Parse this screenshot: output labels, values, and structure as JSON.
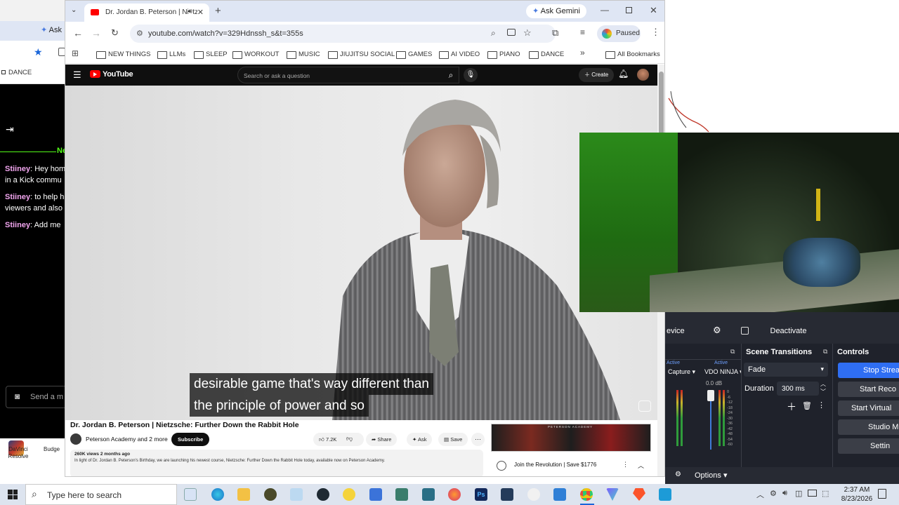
{
  "left_window": {
    "tab_label": "Ask",
    "bookmark": "DANCE",
    "chat": [
      {
        "name": "Stiiney",
        "text": ": Hey hom",
        "text2": "in a Kick commu"
      },
      {
        "name": "Stiiney",
        "text": ": to help h",
        "text2": "viewers and also"
      },
      {
        "name": "Stiiney",
        "text": ": Add me",
        "text2": ""
      }
    ],
    "chat_header": "Ne",
    "send_placeholder": "Send a m",
    "desktop_icons": [
      "DaVinci Resolve",
      "Budge"
    ]
  },
  "chrome": {
    "tab_title": "Dr. Jordan B. Peterson | Nietz",
    "ask_gemini": "Ask Gemini",
    "url": "youtube.com/watch?v=329Hdnssh_s&t=355s",
    "profile_status": "Paused",
    "bookmarks": [
      "NEW THINGS",
      "LLMs",
      "SLEEP",
      "WORKOUT",
      "MUSIC",
      "JIUJITSU SOCIAL",
      "GAMES",
      "AI VIDEO",
      "PIANO",
      "DANCE"
    ],
    "all_bookmarks": "All Bookmarks",
    "more_bookmarks": "»"
  },
  "youtube": {
    "logo": "YouTube",
    "search_placeholder": "Search or ask a question",
    "create_label": "Create",
    "caption_line1": "desirable game that's way different than",
    "caption_line2": "the principle of power and so",
    "video_title": "Dr. Jordan B. Peterson | Nietzsche: Further Down the Rabbit Hole",
    "channel": "Peterson Academy and 2 more",
    "subscribe": "Subscribe",
    "likes": "7.2K",
    "share": "Share",
    "ask": "Ask",
    "save": "Save",
    "views": "260K views  2 months ago",
    "description": "In light of Dr. Jordan B. Peterson's Birthday, we are launching his newest course, Nietzsche: Further Down the Rabbit Hole today, available now on Peterson Academy.",
    "ad_text": "Join the Revolution | Save $1776",
    "ad_banner": "PETERSON ACADEMY"
  },
  "obs": {
    "device_label": "evice",
    "deactivate": "Deactivate",
    "scene_transitions": "Scene Transitions",
    "controls": "Controls",
    "mixer_active1": "Active",
    "mixer_active2": "Active",
    "source1": "Capture",
    "source2": "VDO NINJA",
    "db": "0.0 dB",
    "transition": "Fade",
    "duration_label": "Duration",
    "duration_value": "300 ms",
    "options": "Options",
    "control_buttons": [
      "Stop Strea",
      "Start Reco",
      "Start Virtual Ca",
      "Studio M",
      "Settin"
    ],
    "meter_ticks": [
      "0",
      "-6",
      "-12",
      "-18",
      "-24",
      "-30",
      "-36",
      "-42",
      "-48",
      "-54",
      "-60"
    ]
  },
  "taskbar": {
    "search_placeholder": "Type here to search",
    "time": "2:37 AM",
    "date": "8/23/2026"
  },
  "colors": {
    "youtube_red": "#ff0000",
    "obs_blue": "#2f6ef2",
    "kick_green": "#53fc18",
    "chat_name": "#f3a6f0"
  }
}
